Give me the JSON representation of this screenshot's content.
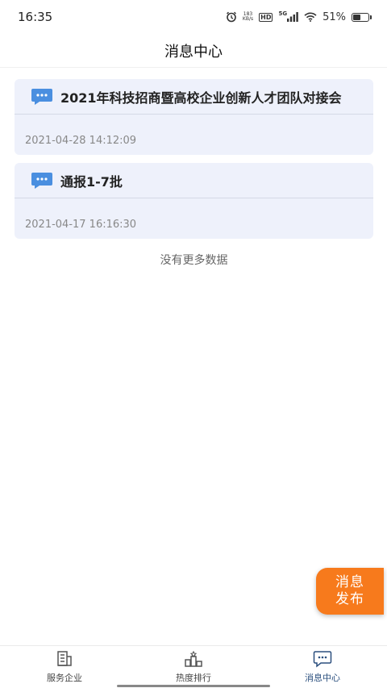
{
  "status_bar": {
    "time": "16:35",
    "net_speed_value": "183",
    "net_speed_unit": "KB/s",
    "hd": "HD",
    "network": "5G",
    "battery": "51%",
    "battery_level": 0.51
  },
  "header": {
    "title": "消息中心"
  },
  "messages": [
    {
      "title": "2021年科技招商暨高校企业创新人才团队对接会",
      "time": "2021-04-28 14:12:09",
      "icon": "chat-bubble-icon"
    },
    {
      "title": "通报1-7批",
      "time": "2021-04-17 16:16:30",
      "icon": "chat-bubble-icon"
    }
  ],
  "no_more_text": "没有更多数据",
  "fab": {
    "line1": "消息",
    "line2": "发布"
  },
  "tabbar": {
    "tabs": [
      {
        "label": "服务企业",
        "icon": "document-icon",
        "active": false
      },
      {
        "label": "热度排行",
        "icon": "ranking-icon",
        "active": false
      },
      {
        "label": "消息中心",
        "icon": "message-icon",
        "active": true
      }
    ]
  },
  "colors": {
    "accent": "#2b4f7e",
    "fab": "#f77a1c",
    "card_bg": "#eef1fb",
    "icon_blue": "#4a8fe0"
  }
}
